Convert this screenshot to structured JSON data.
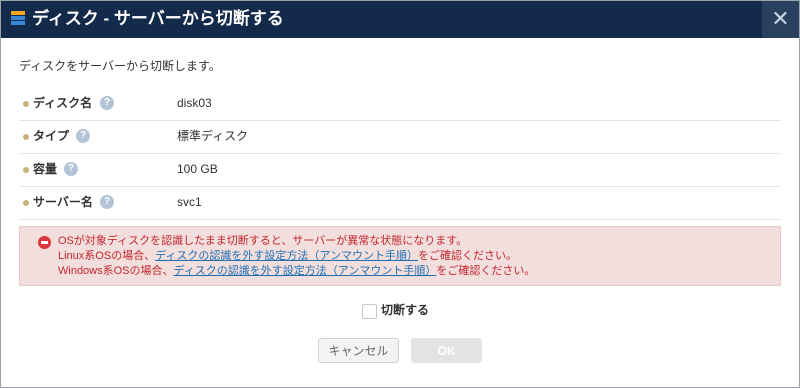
{
  "dialog": {
    "title": "ディスク - サーバーから切断する",
    "close_glyph": "✕",
    "description": "ディスクをサーバーから切断します。"
  },
  "details": [
    {
      "label": "ディスク名",
      "value": "disk03"
    },
    {
      "label": "タイプ",
      "value": "標準ディスク"
    },
    {
      "label": "容量",
      "value": "100 GB"
    },
    {
      "label": "サーバー名",
      "value": "svc1"
    }
  ],
  "help_glyph": "?",
  "warning": {
    "line1": "OSが対象ディスクを認識したまま切断すると、サーバーが異常な状態になります。",
    "line2_prefix": "Linux系OSの場合、",
    "line2_link": "ディスクの認識を外す設定方法（アンマウント手順）",
    "line2_suffix": "をご確認ください。",
    "line3_prefix": "Windows系OSの場合、",
    "line3_link": "ディスクの認識を外す設定方法（アンマウント手順）",
    "line3_suffix": "をご確認ください。"
  },
  "confirm_label": "切断する",
  "buttons": {
    "cancel": "キャンセル",
    "ok": "OK"
  },
  "colors": {
    "titlebar": "#132a4a",
    "close_bg": "#29405f",
    "alert_bg": "#f3dede",
    "alert_text": "#c2272d",
    "link": "#1f6fb2"
  },
  "icons": {
    "title": "disk-stack-icon",
    "close": "close-icon",
    "help": "help-icon",
    "alert": "no-entry-icon"
  }
}
